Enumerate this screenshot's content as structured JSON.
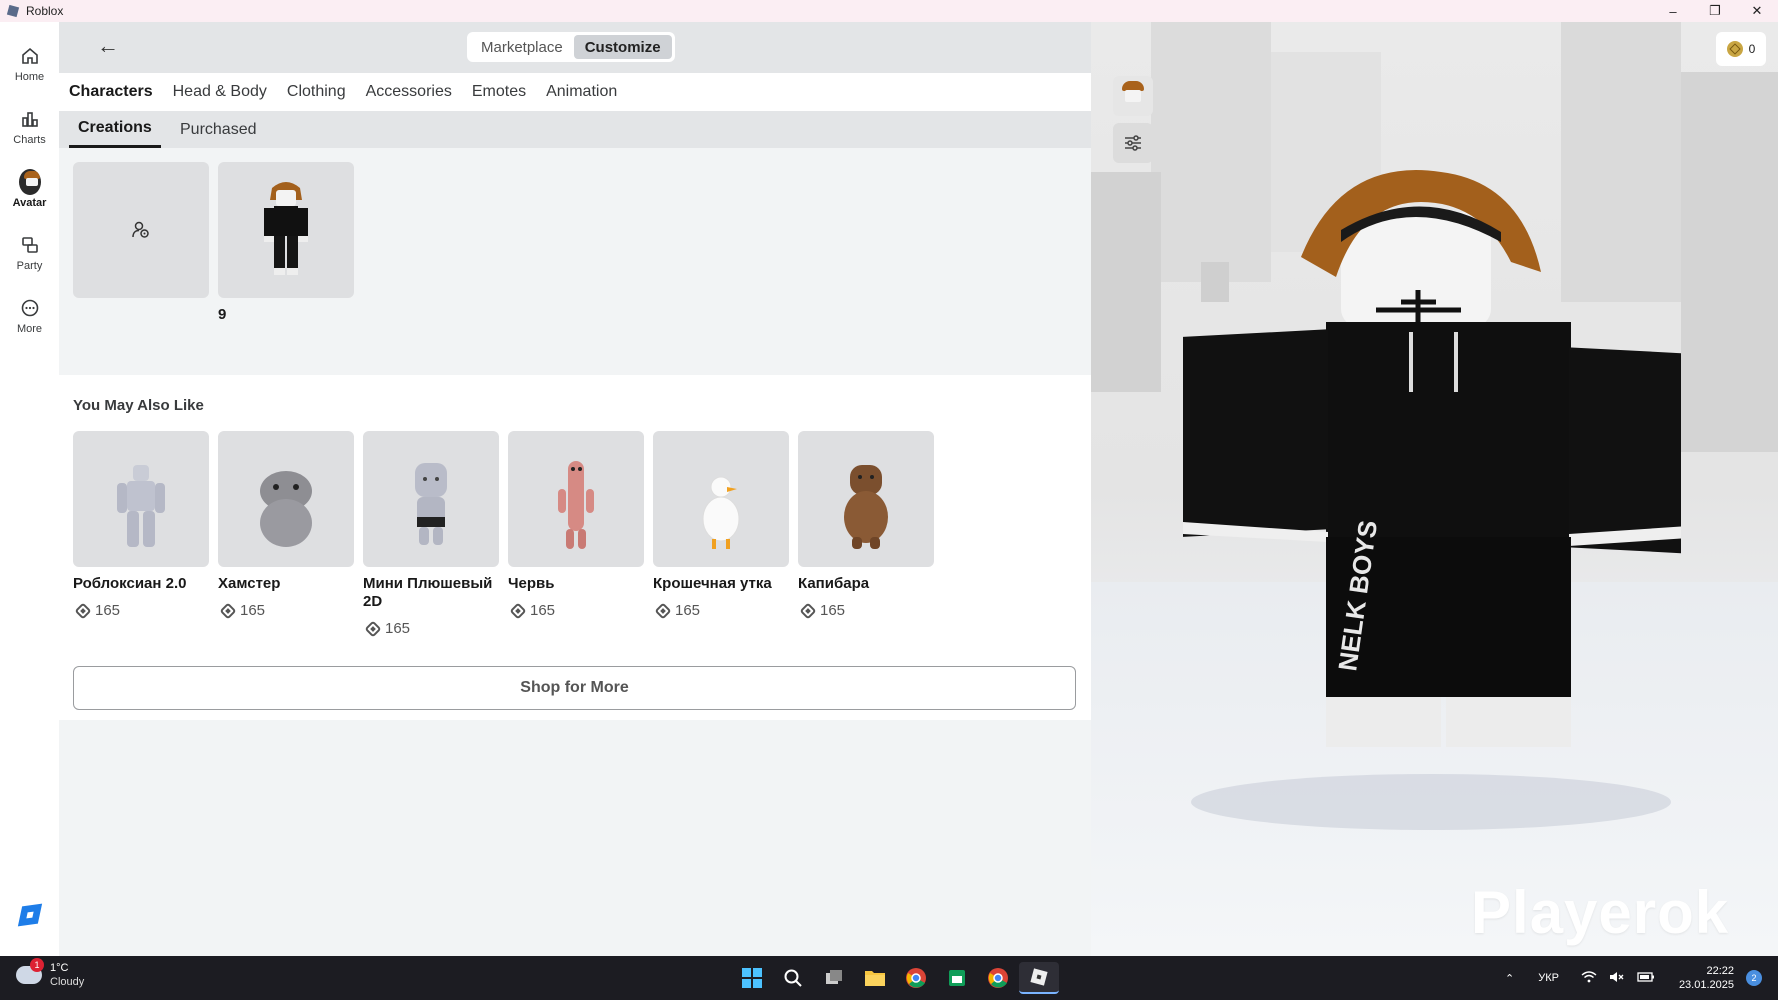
{
  "window": {
    "title": "Roblox",
    "controls": [
      "–",
      "❐",
      "✕"
    ]
  },
  "nav": {
    "items": [
      {
        "label": "Home",
        "icon": "home-icon"
      },
      {
        "label": "Charts",
        "icon": "charts-icon"
      },
      {
        "label": "Avatar",
        "icon": "avatar-icon"
      },
      {
        "label": "Party",
        "icon": "party-icon"
      },
      {
        "label": "More",
        "icon": "more-icon"
      }
    ],
    "active": "Avatar"
  },
  "header": {
    "back_icon": "←",
    "segments": [
      "Marketplace",
      "Customize"
    ],
    "selected_segment": "Customize"
  },
  "category_tabs": [
    "Characters",
    "Head & Body",
    "Clothing",
    "Accessories",
    "Emotes",
    "Animation"
  ],
  "selected_category": "Characters",
  "sub_tabs": [
    "Creations",
    "Purchased"
  ],
  "selected_sub_tab": "Creations",
  "creations": {
    "items": [
      {
        "caption": "",
        "kind": "create-new"
      },
      {
        "caption": "9",
        "kind": "character"
      }
    ]
  },
  "recommendations": {
    "title": "You May Also Like",
    "items": [
      {
        "name": "Роблоксиан 2.0",
        "price": "165"
      },
      {
        "name": "Хамстер",
        "price": "165"
      },
      {
        "name": "Мини Плюшевый 2D",
        "price": "165"
      },
      {
        "name": "Червь",
        "price": "165"
      },
      {
        "name": "Крошечная утка",
        "price": "165"
      },
      {
        "name": "Капибара",
        "price": "165"
      }
    ],
    "shop_more": "Shop for More"
  },
  "preview": {
    "robux_balance": "0",
    "watermark": "Playerok",
    "shirt_text": "NELK BOYS"
  },
  "taskbar": {
    "weather_temp": "1°C",
    "weather_desc": "Cloudy",
    "weather_badge": "1",
    "language": "УКР",
    "time": "22:22",
    "date": "23.01.2025",
    "notifications": "2"
  },
  "colors": {
    "main_bg": "#f2f4f5",
    "header_bg": "#e3e5e7",
    "tile_bg": "#dedfe1",
    "taskbar_bg": "#1c1c22"
  }
}
